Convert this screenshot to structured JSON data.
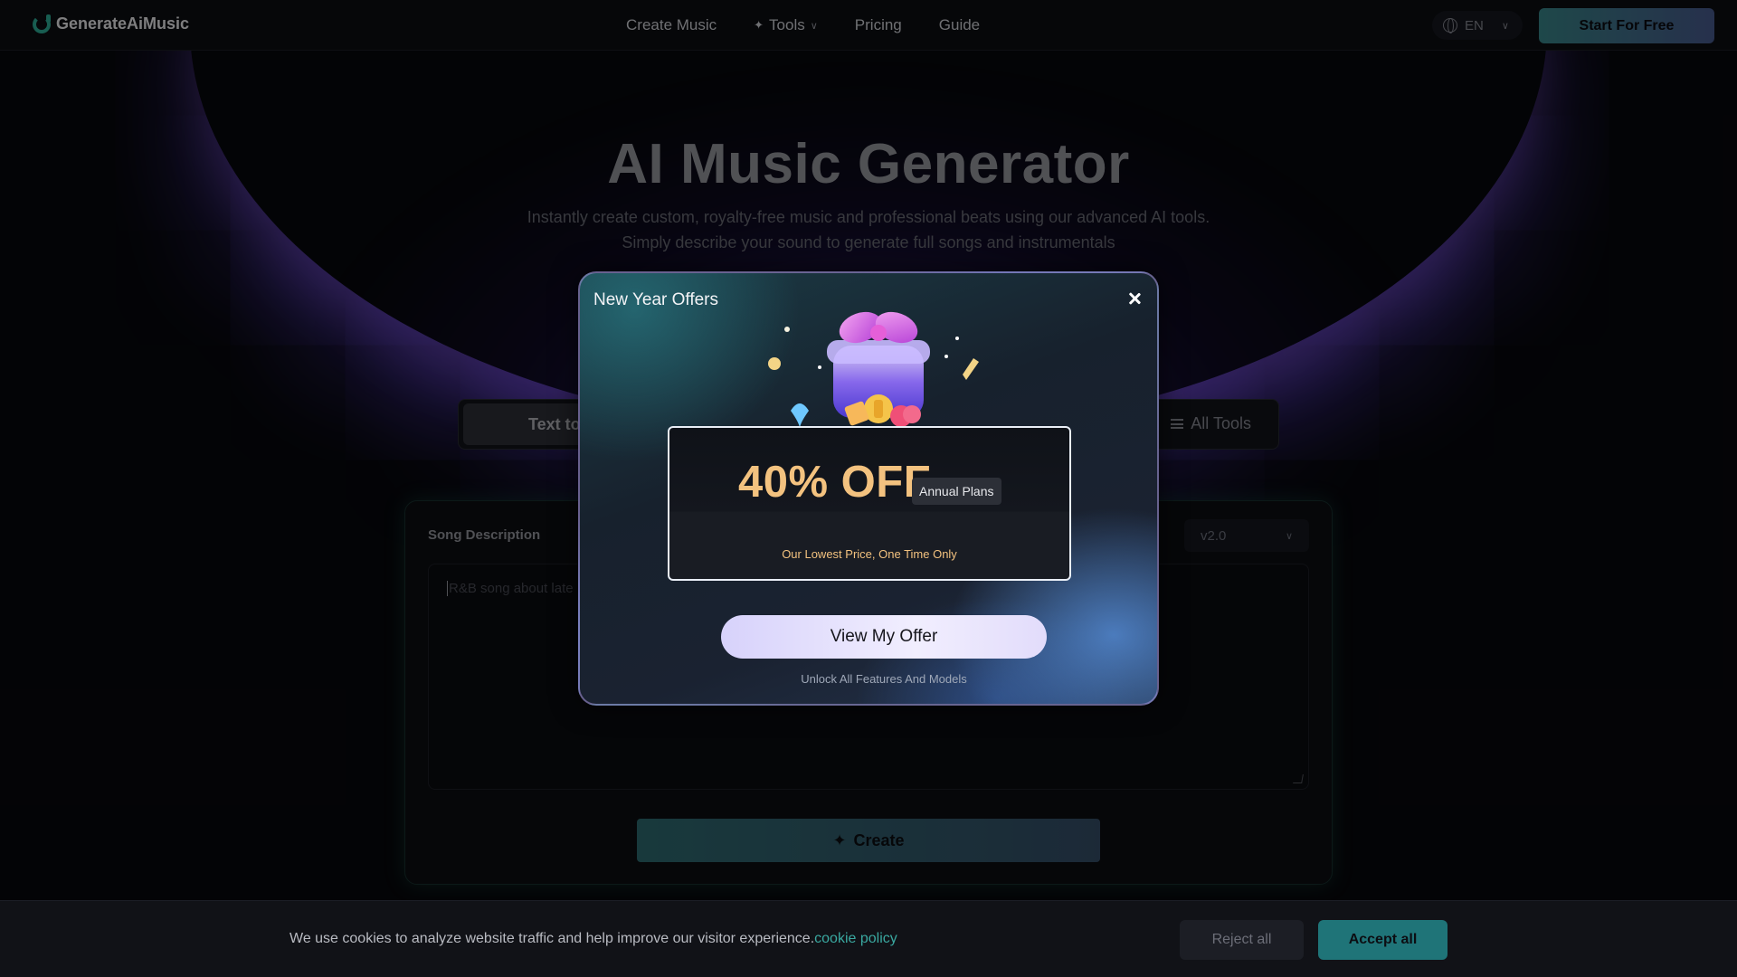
{
  "header": {
    "brand": "GenerateAiMusic",
    "nav": [
      {
        "label": "Create Music"
      },
      {
        "label": "Tools"
      },
      {
        "label": "Pricing"
      },
      {
        "label": "Guide"
      }
    ],
    "language": "EN",
    "cta_label": "Start For Free"
  },
  "hero": {
    "title": "AI Music Generator",
    "subtitle_line1": "Instantly create custom, royalty-free music and professional beats using our advanced AI tools.",
    "subtitle_line2": "Simply describe your sound to generate full songs and instrumentals"
  },
  "tabs": {
    "active_label": "Text to",
    "all_tools_label": "All Tools"
  },
  "generator": {
    "song_description_label": "Song Description",
    "model_version": "v2.0",
    "input_placeholder": "R&B song about late",
    "create_label": "Create"
  },
  "cookie": {
    "message": "We use cookies to analyze website traffic and help improve our visitor experience.",
    "link_label": "cookie policy",
    "reject_label": "Reject all",
    "accept_label": "Accept all"
  },
  "modal": {
    "title": "New Year Offers",
    "discount": "40% OFF",
    "plan_badge": "Annual Plans",
    "tagline": "Our Lowest Price, One Time Only",
    "cta_label": "View My Offer",
    "footnote": "Unlock All Features And Models"
  },
  "colors": {
    "accent_teal": "#1f7478",
    "offer_gold": "#f3c27f",
    "modal_border": "#aa96dc"
  }
}
